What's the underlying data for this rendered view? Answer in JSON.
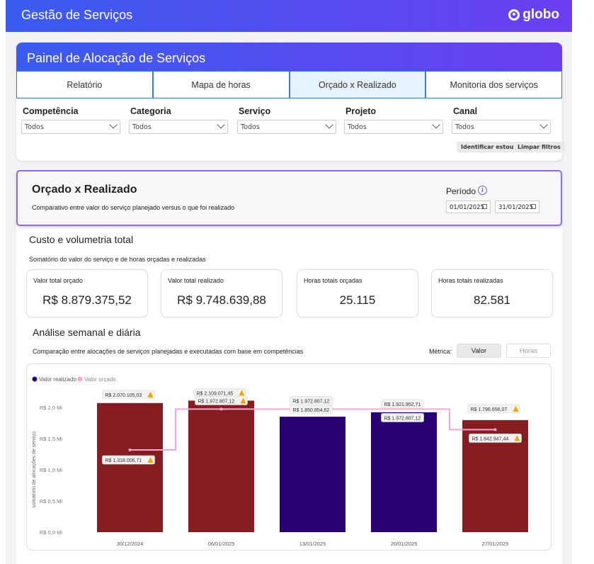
{
  "header": {
    "title": "Gestão de Serviços",
    "logo_text": "globo"
  },
  "panel": {
    "title": "Painel de Alocação de Serviços",
    "tabs": [
      {
        "label": "Relatório",
        "active": false
      },
      {
        "label": "Mapa de horas",
        "active": false
      },
      {
        "label": "Orçado x Realizado",
        "active": true
      },
      {
        "label": "Monitoria dos serviços",
        "active": false
      }
    ],
    "filters": [
      {
        "label": "Competência",
        "value": "Todos"
      },
      {
        "label": "Categoria",
        "value": "Todos"
      },
      {
        "label": "Serviço",
        "value": "Todos"
      },
      {
        "label": "Projeto",
        "value": "Todos"
      },
      {
        "label": "Canal",
        "value": "Todos"
      }
    ],
    "identify_label": "Identificar estouro",
    "clear_label": "Limpar filtros"
  },
  "period_section": {
    "title": "Orçado x Realizado",
    "subtitle": "Comparativo entre valor do serviço planejado versus o que foi realizado",
    "period_label": "Período",
    "info_glyph": "i",
    "start_date": "01/01/2025",
    "end_date": "31/01/2025"
  },
  "totals": {
    "title": "Custo e volumetria total",
    "subtitle": "Somatório do valor do serviço e de horas orçadas e realizadas",
    "kpis": [
      {
        "label": "Valor total orçado",
        "value": "R$ 8.879.375,52"
      },
      {
        "label": "Valor total realizado",
        "value": "R$ 9.748.639,88"
      },
      {
        "label": "Horas totais orçadas",
        "value": "25.115"
      },
      {
        "label": "Horas totais realizadas",
        "value": "82.581"
      }
    ]
  },
  "analysis": {
    "title": "Análise semanal e diária",
    "subtitle": "Comparação entre alocações de serviços planejadas e executadas com base em competências",
    "metric_label": "Métrica:",
    "metric_options": [
      "Valor",
      "Horas"
    ],
    "metric_selected": "Valor"
  },
  "colors": {
    "over_budget": "#861d21",
    "under_budget": "#270071",
    "budget_line": "#f7a6d2",
    "realizado_legend": "#270071",
    "orcado_legend": "#f7a6d2",
    "warning": "#f0a500"
  },
  "chart_data": {
    "type": "bar",
    "legend": [
      "Valor realizado",
      "Valor orçado"
    ],
    "ylabel": "somatório de alocações de serviço",
    "ylim": [
      0,
      2.0
    ],
    "yticks": [
      "R$ 0,0 Mi",
      "R$ 0,5 Mi",
      "R$ 1,0 Mi",
      "R$ 1,5 Mi",
      "R$ 2,0 Mi"
    ],
    "categories": [
      "30/12/2024",
      "06/01/2025",
      "13/01/2025",
      "20/01/2025",
      "27/01/2025"
    ],
    "series": [
      {
        "name": "Valor realizado",
        "values": [
          2.070105,
          2.109071,
          1.850854,
          1.921952,
          1.796656
        ],
        "labels": [
          "R$ 2.070.105,03",
          "R$ 2.109.071,45",
          "R$ 1.850.854,62",
          "R$ 1.921.952,71",
          "R$ 1.796.656,07"
        ],
        "over_budget": [
          true,
          true,
          false,
          false,
          true
        ]
      },
      {
        "name": "Valor orçado",
        "values": [
          1.318007,
          1.972807,
          1.972807,
          1.972807,
          1.642947
        ],
        "labels": [
          "R$ 1.318.006,71",
          "R$ 1.972.807,12",
          "R$ 1.972.807,12",
          "R$ 1.972.807,12",
          "R$ 1.642.947,44"
        ]
      }
    ]
  }
}
